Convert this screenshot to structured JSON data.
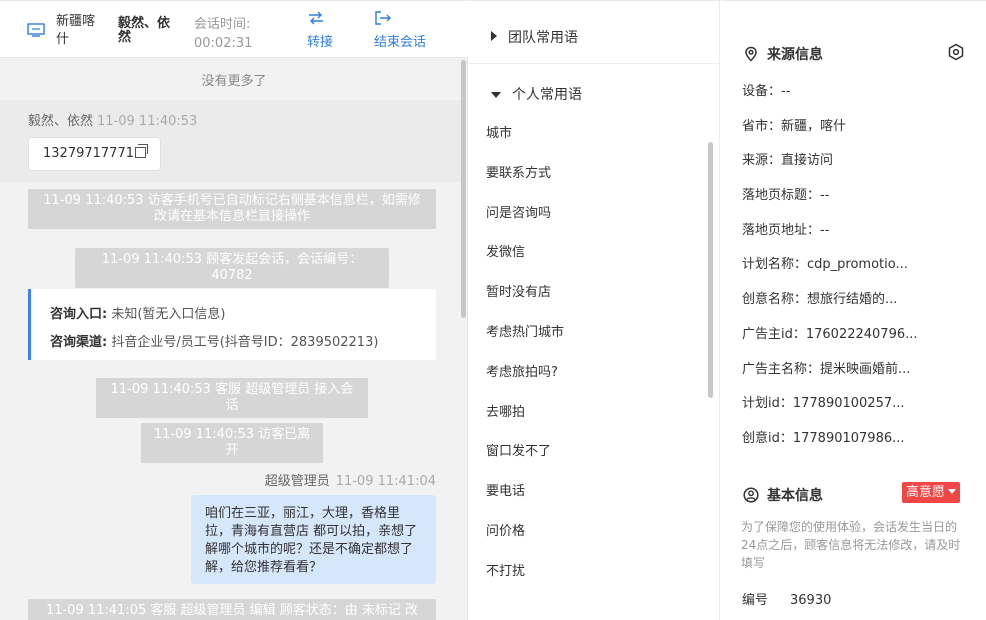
{
  "header": {
    "location": "新疆喀什",
    "visitor_name": "毅然、依然",
    "session_time_label": "会话时间:",
    "session_time": "00:02:31",
    "transfer_label": "转接",
    "end_label": "结束会话"
  },
  "chat": {
    "no_more": "没有更多了",
    "visitor_msg": {
      "sender": "毅然、依然",
      "time": "11-09 11:40:53",
      "text": "13279717771"
    },
    "system1": "11-09 11:40:53 访客手机号已自动标记右侧基本信息栏，如需修改请在基本信息栏直接操作",
    "system2": "11-09 11:40:53 顾客发起会话，会话编号：40782",
    "entry_card": {
      "entry_label": "咨询入口:",
      "entry_value": "未知(暂无入口信息)",
      "channel_label": "咨询渠道:",
      "channel_value": "抖音企业号/员工号(抖音号ID：2839502213)"
    },
    "system3": "11-09 11:40:53 客服 超级管理员 接入会话",
    "system4": "11-09 11:40:53 访客已离开",
    "agent_msg": {
      "sender": "超级管理员",
      "time": "11-09 11:41:04",
      "text": "咱们在三亚，丽江，大理，香格里拉，青海有直营店 都可以拍，亲想了解哪个城市的呢？还是不确定都想了解，给您推荐看看？"
    },
    "system5": "11-09 11:41:05 客服 超级管理员 编辑 顾客状态：由 未标记 改"
  },
  "phrases": {
    "team_group": "团队常用语",
    "personal_group": "个人常用语",
    "items": [
      "城市",
      "要联系方式",
      "问是咨询吗",
      "发微信",
      "暂时没有店",
      "考虑热门城市",
      "考虑旅拍吗?",
      "去哪拍",
      "窗口发不了",
      "要电话",
      "问价格",
      "不打扰"
    ]
  },
  "info": {
    "source_title": "来源信息",
    "source_items": [
      "设备：--",
      "省市：新疆，喀什",
      "来源：直接访问",
      "落地页标题：--",
      "落地页地址：--",
      "计划名称：cdp_promotio...",
      "创意名称：想旅行结婚的...",
      "广告主id：176022240796...",
      "广告主名称：提米映画婚前...",
      "计划id：177890100257...",
      "创意id：177890107986..."
    ],
    "basic_title": "基本信息",
    "intent_badge": "高意愿",
    "notice": "为了保障您的使用体验，会话发生当日的24点之后，顾客信息将无法修改，请及时填写",
    "number_label": "编号",
    "number_value": "36930"
  },
  "colors": {
    "accent": "#2f7ddd",
    "badge": "#f04646",
    "agent_bubble": "#d6e6fb",
    "system_msg": "#d6d6d6"
  }
}
